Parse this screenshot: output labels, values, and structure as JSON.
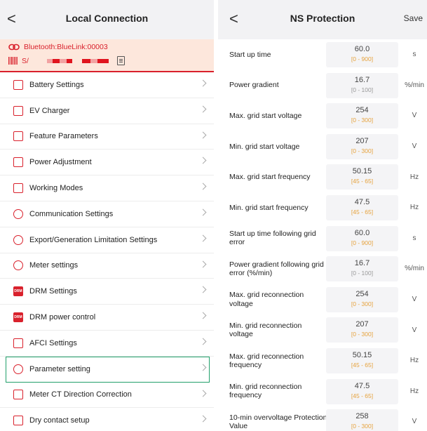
{
  "left_panel": {
    "header": {
      "back_label": "<",
      "title": "Local Connection"
    },
    "connection": {
      "bluetooth_text": "Bluetooth:BlueLink:00003",
      "serial_prefix": "S/",
      "accent_color": "#d9212c"
    },
    "menu": [
      {
        "label": "Battery Settings",
        "icon": "battery-icon"
      },
      {
        "label": "EV Charger",
        "icon": "ev-charger-icon"
      },
      {
        "label": "Feature Parameters",
        "icon": "toolbox-icon"
      },
      {
        "label": "Power Adjustment",
        "icon": "chart-icon"
      },
      {
        "label": "Working Modes",
        "icon": "edit-icon"
      },
      {
        "label": "Communication Settings",
        "icon": "antenna-icon"
      },
      {
        "label": "Export/Generation Limitation Settings",
        "icon": "limit-icon"
      },
      {
        "label": "Meter settings",
        "icon": "gauge-icon"
      },
      {
        "label": "DRM Settings",
        "icon": "drm-icon",
        "icon_text": "DRM"
      },
      {
        "label": "DRM power control",
        "icon": "drm-icon",
        "icon_text": "DRM"
      },
      {
        "label": "AFCI Settings",
        "icon": "afci-icon"
      },
      {
        "label": "Parameter setting",
        "icon": "parameter-icon",
        "selected": true
      },
      {
        "label": "Meter CT Direction Correction",
        "icon": "ct-icon"
      },
      {
        "label": "Dry contact setup",
        "icon": "dry-contact-icon"
      }
    ]
  },
  "right_panel": {
    "header": {
      "back_label": "<",
      "title": "NS Protection",
      "save_label": "Save"
    },
    "range_colors": {
      "normal": "#999999",
      "highlight": "#e6a23c"
    },
    "params": [
      {
        "label": "Start up time",
        "value": "60.0",
        "range": "[0 - 900]",
        "unit": "s",
        "range_color": "#e6a23c"
      },
      {
        "label": "Power gradient",
        "value": "16.7",
        "range": "[0 - 100]",
        "unit": "%/min",
        "range_color": "#999999"
      },
      {
        "label": "Max. grid start voltage",
        "value": "254",
        "range": "[0 - 300]",
        "unit": "V",
        "range_color": "#e6a23c"
      },
      {
        "label": "Min. grid start voltage",
        "value": "207",
        "range": "[0 - 300]",
        "unit": "V",
        "range_color": "#e6a23c"
      },
      {
        "label": "Max. grid start frequency",
        "value": "50.15",
        "range": "[45 - 65]",
        "unit": "Hz",
        "range_color": "#e6a23c"
      },
      {
        "label": "Min. grid start frequency",
        "value": "47.5",
        "range": "[45 - 65]",
        "unit": "Hz",
        "range_color": "#e6a23c"
      },
      {
        "label": "Start up time following grid error",
        "value": "60.0",
        "range": "[0 - 900]",
        "unit": "s",
        "range_color": "#e6a23c"
      },
      {
        "label": "Power gradient following grid error (%/min)",
        "value": "16.7",
        "range": "[0 - 100]",
        "unit": "%/min",
        "range_color": "#999999"
      },
      {
        "label": "Max. grid reconnection voltage",
        "value": "254",
        "range": "[0 - 300]",
        "unit": "V",
        "range_color": "#e6a23c"
      },
      {
        "label": "Min. grid reconnection voltage",
        "value": "207",
        "range": "[0 - 300]",
        "unit": "V",
        "range_color": "#e6a23c"
      },
      {
        "label": "Max. grid reconnection frequency",
        "value": "50.15",
        "range": "[45 - 65]",
        "unit": "Hz",
        "range_color": "#e6a23c"
      },
      {
        "label": "Min. grid reconnection frequency",
        "value": "47.5",
        "range": "[45 - 65]",
        "unit": "Hz",
        "range_color": "#e6a23c"
      },
      {
        "label": "10-min overvoltage Protection Value",
        "value": "258",
        "range": "[0 - 300]",
        "unit": "V",
        "range_color": "#e6a23c"
      }
    ]
  }
}
